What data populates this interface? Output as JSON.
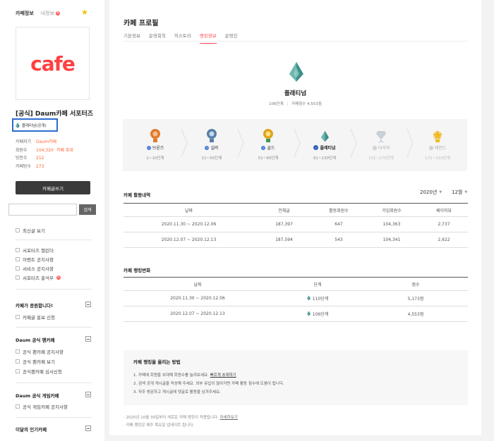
{
  "sidebar": {
    "tab_cafe_info": "카페정보",
    "tab_my_info": "내정보",
    "badge": "N",
    "logo_text": "cafe",
    "cafe_name": "[공식] Daum카페 서포터즈",
    "rank_label": "플래티넘(공개)",
    "info": [
      {
        "key": "카페지기",
        "value": "Daum카페",
        "extra": ""
      },
      {
        "key": "회원수",
        "value": "104,320",
        "extra": "카페 초대"
      },
      {
        "key": "방문수",
        "value": "212",
        "extra": ""
      },
      {
        "key": "카페방수",
        "value": "273",
        "extra": ""
      }
    ],
    "write_button": "카페글쓰기",
    "search_placeholder": "",
    "search_button": "검색",
    "menu_recent": "최신글 보기",
    "menu_group1": [
      "서포터즈 캘린더",
      "이벤트 공지사항",
      "서비스 공지사항",
      "서포터즈 출석부"
    ],
    "section2_title": "카페가 응원합니다!",
    "section2_items": [
      "카페글 홍보 신청"
    ],
    "section3_title": "Daum 공식 팬카페",
    "section3_items": [
      "공식 팬카페 공지사항",
      "공식 팬카페 보기",
      "공식팬카페 심사신청"
    ],
    "section4_title": "Daum 공식 게임카페",
    "section4_items": [
      "공식 게임카페 공지사항"
    ],
    "section5_title": "이달의 인기카페"
  },
  "main": {
    "title": "카페 프로필",
    "tabs": [
      "기본정보",
      "운영회칙",
      "히스토리",
      "랭킹정보",
      "운영진"
    ],
    "active_tab": 3,
    "rank_name": "플래티넘",
    "rank_level": "106단계",
    "rank_score": "카페점수 4,553점",
    "steps": [
      {
        "name": "브론즈",
        "range": "1~10단계",
        "state": "done",
        "icon": "bronze-medal-icon",
        "color": "#e07b2d"
      },
      {
        "name": "실버",
        "range": "11~50단계",
        "state": "done",
        "icon": "silver-medal-icon",
        "color": "#5a7fa8"
      },
      {
        "name": "골드",
        "range": "51~90단계",
        "state": "done",
        "icon": "gold-medal-icon",
        "color": "#e0a41a"
      },
      {
        "name": "플래티넘",
        "range": "91~130단계",
        "state": "current",
        "icon": "platinum-gem-icon",
        "color": "#3f8f8a"
      },
      {
        "name": "다이아",
        "range": "131~170단계",
        "state": "future",
        "icon": "diamond-icon",
        "color": "#b9c2cc"
      },
      {
        "name": "레전드",
        "range": "171~210단계",
        "state": "future",
        "icon": "legend-icon",
        "color": "#f0c14a"
      }
    ],
    "activity_title": "카페 활동내역",
    "year_select": "2020년",
    "month_select": "12월",
    "activity_headers": [
      "날짜",
      "전체글",
      "활동회원수",
      "가입회원수",
      "페이지뷰"
    ],
    "activity_rows": [
      [
        "2020.11.30 ~ 2020.12.06",
        "187,397",
        "647",
        "104,363",
        "2,737"
      ],
      [
        "2020.12.07 ~ 2020.12.13",
        "187,594",
        "543",
        "104,341",
        "2,622"
      ]
    ],
    "ranking_title": "카페 랭킹변화",
    "ranking_headers": [
      "날짜",
      "단계",
      "점수"
    ],
    "ranking_rows": [
      [
        "2020.11.30 ~ 2020.12.06",
        "110단계",
        "5,173점"
      ],
      [
        "2020.12.07 ~ 2020.12.13",
        "106단계",
        "4,553점"
      ]
    ],
    "how_title": "카페 랭킹을 올리는 방법",
    "how_line1": "1. 카페에 회원을 초대해 회원수를 늘려보세요.",
    "how_link": "빠르게 초대하기",
    "how_line2": "2. 검색 공개 게시글을 작성해 주세요. 외부 유입이 많아지면 카페 활동 점수에 도움이 됩니다.",
    "how_line3": "3. 자주 방문하고 게시글에 댓글로 활동을 남겨주세요.",
    "note1": "· 2020년 10월 30일부터 새로운 카페 랭킹이 적용됩니다.",
    "note1_link": "자세히보기",
    "note2": "· 카페 랭킹은 매주 목요일 업데이트 됩니다."
  }
}
